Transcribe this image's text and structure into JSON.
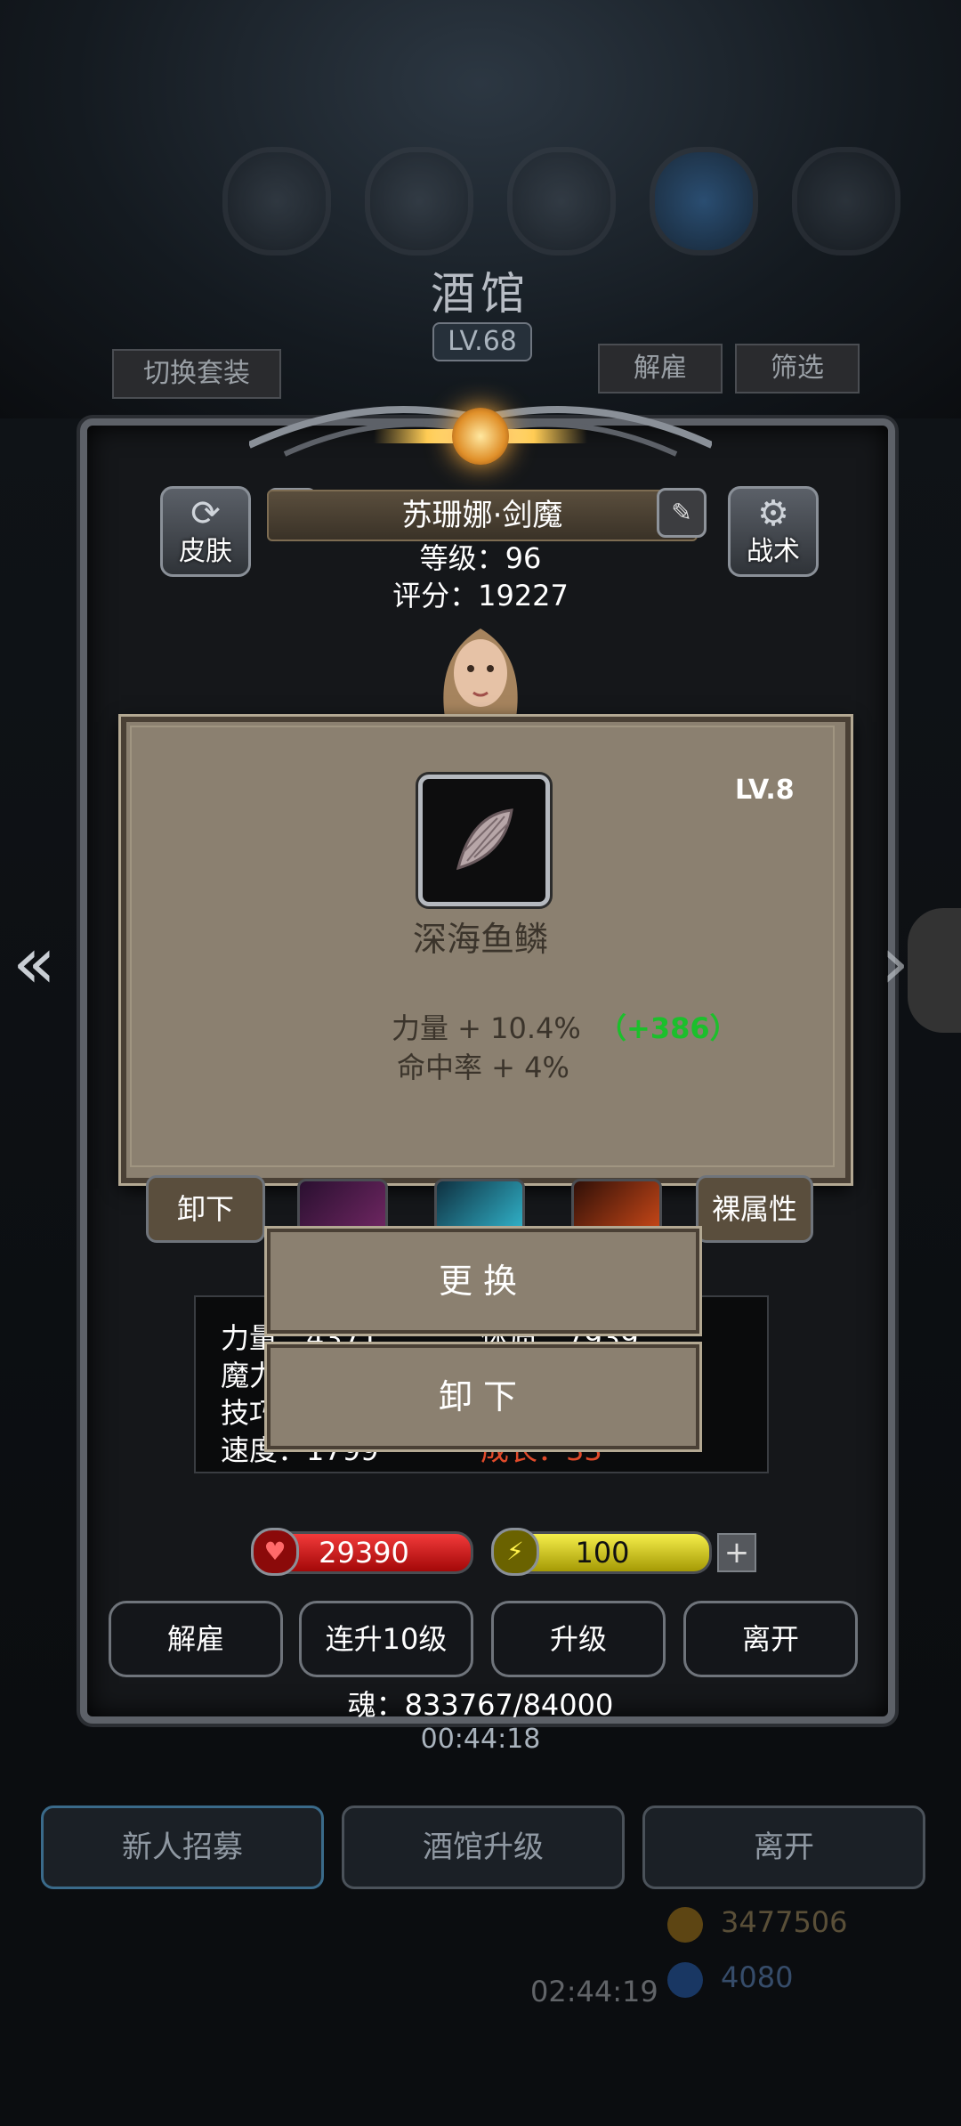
{
  "header": {
    "title": "酒馆",
    "level": "LV.68",
    "switch_outfit": "切换套装",
    "dismiss": "解雇",
    "filter": "筛选"
  },
  "hero": {
    "skin_label": "皮肤",
    "tactics_label": "战术",
    "name": "苏珊娜·剑魔",
    "level_line": "等级：96",
    "score_line": "评分：19227"
  },
  "item_popup": {
    "level": "LV.8",
    "name": "深海鱼鳞",
    "bonus_1": "力量 + 10.4%",
    "bonus_1_extra": "（+386）",
    "bonus_2": "命中率 + 4%"
  },
  "equip_row": {
    "unequip": "卸下",
    "bare_attrs": "裸属性"
  },
  "stats": {
    "line1": "力量：4371",
    "line1b": "体质：7939",
    "line2": "魔力",
    "line3": "技巧",
    "line4": "速度：1799",
    "line4b": "成长：33"
  },
  "context_menu": {
    "replace": "更换",
    "unequip": "卸下"
  },
  "resources": {
    "hp": "29390",
    "energy": "100",
    "plus": "+"
  },
  "actions": {
    "dismiss": "解雇",
    "level10": "连升10级",
    "levelup": "升级",
    "leave": "离开"
  },
  "soul": "魂：833767/84000",
  "timer": "00:44:18",
  "bottom_nav": {
    "recruit": "新人招募",
    "upgrade_tavern": "酒馆升级",
    "leave": "离开"
  },
  "footer": {
    "gold": "3477506",
    "gems": "4080",
    "timer2": "02:44:19"
  },
  "colors": {
    "hp": "#d81e1e",
    "energy": "#e6dc1e",
    "bonus_green": "#1cbf2c",
    "popup_bg": "#8b8070"
  },
  "icons": [
    "skin-icon",
    "gear-icon",
    "medal-icon",
    "edit-icon",
    "heart-icon",
    "lightning-icon",
    "chevron-left-icon",
    "chevron-right-icon"
  ]
}
